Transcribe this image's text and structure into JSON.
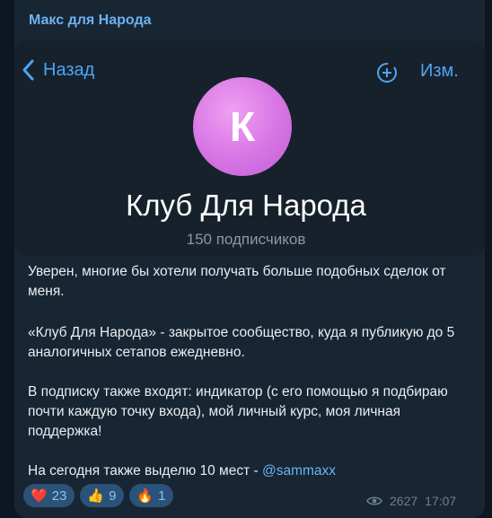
{
  "message": {
    "sender": "Макс для Народа",
    "screenshot": {
      "back_label": "Назад",
      "edit_label": "Изм.",
      "avatar_letter": "К",
      "channel_title": "Клуб Для Народа",
      "subscribers": "150 подписчиков"
    },
    "paragraphs": [
      "Уверен, многие бы хотели получать больше подобных сделок от меня.",
      "«Клуб Для Народа» - закрытое сообщество, куда я публикую до 5 аналогичных сетапов ежедневно.",
      "В подписку также входят: индикатор (с его помощью я подбираю почти каждую точку входа), мой личный курс, моя личная поддержка!"
    ],
    "last_line_prefix": "На сегодня также выделю 10 мест - ",
    "mention": "@sammaxx",
    "reactions": [
      {
        "emoji": "❤️",
        "count": "23",
        "icon": "heart-icon"
      },
      {
        "emoji": "👍",
        "count": "9",
        "icon": "thumbs-up-icon"
      },
      {
        "emoji": "🔥",
        "count": "1",
        "icon": "fire-icon"
      }
    ],
    "views": "2627",
    "time": "17:07"
  },
  "colors": {
    "background": "#0e1621",
    "bubble": "#182533",
    "accent": "#6ab3f3",
    "avatar": "#d674e4",
    "reaction_bg": "#2b5278"
  }
}
